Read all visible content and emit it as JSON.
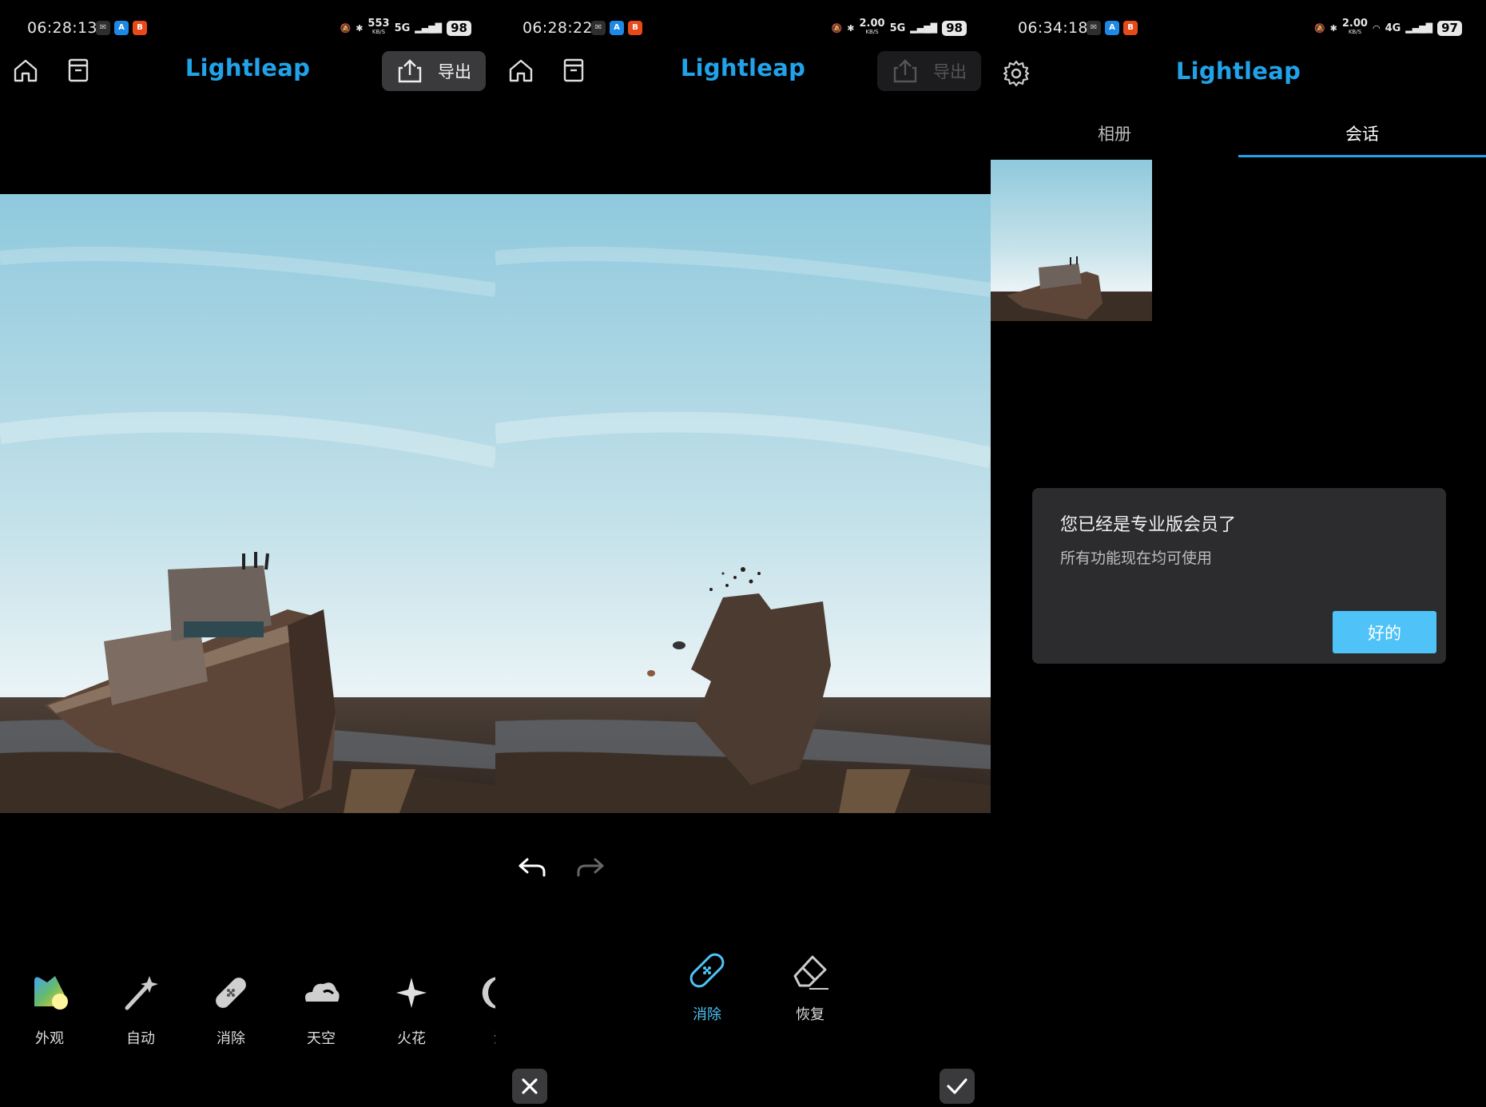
{
  "app_name": "Lightleap",
  "colors": {
    "accent": "#21a3e9",
    "ok_button": "#4fc3f7",
    "dialog_bg": "#2c2c2e",
    "panel_bg": "#000000"
  },
  "screens": [
    {
      "status": {
        "time": "06:28:13",
        "net_speed": "553",
        "net_unit": "KB/S",
        "signal": "5G",
        "battery": "98"
      },
      "header": {
        "export_label": "导出"
      },
      "tools": [
        {
          "label": "外观",
          "icon": "appearance-icon"
        },
        {
          "label": "自动",
          "icon": "magic-wand-icon"
        },
        {
          "label": "消除",
          "icon": "bandage-icon"
        },
        {
          "label": "天空",
          "icon": "sky-cloud-icon"
        },
        {
          "label": "火花",
          "icon": "sparkle-icon"
        },
        {
          "label": "滤",
          "icon": "moon-icon"
        }
      ]
    },
    {
      "status": {
        "time": "06:28:22",
        "net_speed": "2.00",
        "net_unit": "KB/S",
        "signal": "5G",
        "battery": "98"
      },
      "header": {
        "export_label": "导出"
      },
      "brush_tools": [
        {
          "label": "消除",
          "icon": "bandage-icon",
          "selected": true
        },
        {
          "label": "恢复",
          "icon": "eraser-icon",
          "selected": false
        }
      ]
    },
    {
      "status": {
        "time": "06:34:18",
        "net_speed": "2.00",
        "net_unit": "KB/S",
        "signal": "4G",
        "battery": "97"
      },
      "tabs": [
        {
          "label": "相册",
          "active": false
        },
        {
          "label": "会话",
          "active": true
        }
      ],
      "dialog": {
        "title": "您已经是专业版会员了",
        "message": "所有功能现在均可使用",
        "ok_label": "好的"
      }
    }
  ]
}
